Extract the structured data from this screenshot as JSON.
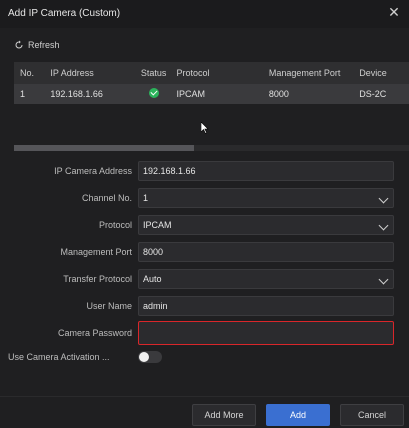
{
  "dialog": {
    "title": "Add IP Camera (Custom)"
  },
  "toolbar": {
    "refresh_label": "Refresh"
  },
  "table": {
    "headers": [
      "No.",
      "IP Address",
      "Status",
      "Protocol",
      "Management Port",
      "Device"
    ],
    "rows": [
      {
        "no": "1",
        "ip": "192.168.1.66",
        "status": "online",
        "protocol": "IPCAM",
        "port": "8000",
        "device": "DS-2C"
      }
    ]
  },
  "form": {
    "ip_label": "IP Camera Address",
    "ip_value": "192.168.1.66",
    "channel_label": "Channel No.",
    "channel_value": "1",
    "protocol_label": "Protocol",
    "protocol_value": "IPCAM",
    "port_label": "Management Port",
    "port_value": "8000",
    "transfer_label": "Transfer Protocol",
    "transfer_value": "Auto",
    "user_label": "User Name",
    "user_value": "admin",
    "password_label": "Camera Password",
    "password_value": "",
    "activation_label": "Use Camera Activation ...",
    "activation_on": false
  },
  "buttons": {
    "add_more": "Add More",
    "add": "Add",
    "cancel": "Cancel"
  },
  "colors": {
    "accent": "#3a6fd1",
    "error": "#d9262a",
    "status_ok": "#2bb35b"
  }
}
